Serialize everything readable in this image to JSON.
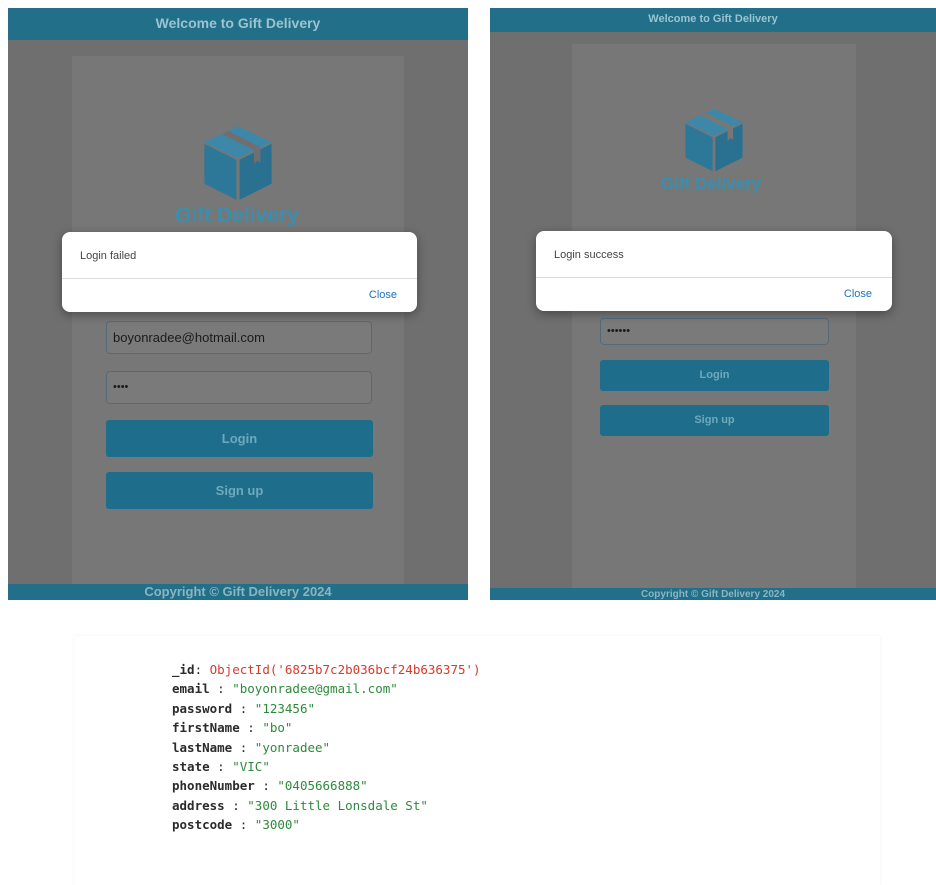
{
  "left_screen": {
    "header": "Welcome to Gift Delivery",
    "brand": "Gift Delivery",
    "email_value": "boyonradee@hotmail.com",
    "password_mask": "••••",
    "login_label": "Login",
    "signup_label": "Sign up",
    "footer": "Copyright © Gift Delivery 2024",
    "dialog": {
      "message": "Login failed",
      "close_label": "Close"
    }
  },
  "right_screen": {
    "header": "Welcome to Gift Delivery",
    "brand": "Gift Delivery",
    "password_mask": "••••••",
    "login_label": "Login",
    "signup_label": "Sign up",
    "footer": "Copyright © Gift Delivery 2024",
    "dialog": {
      "message": "Login success",
      "close_label": "Close"
    }
  },
  "db_record": {
    "id_key": "_id",
    "id_value": "ObjectId('6825b7c2b036bcf24b636375')",
    "fields": [
      {
        "key": "email",
        "value": "\"boyonradee@gmail.com\""
      },
      {
        "key": "password",
        "value": "\"123456\""
      },
      {
        "key": "firstName",
        "value": "\"bo\""
      },
      {
        "key": "lastName",
        "value": "\"yonradee\""
      },
      {
        "key": "state",
        "value": "\"VIC\""
      },
      {
        "key": "phoneNumber",
        "value": "\"0405666888\""
      },
      {
        "key": "address",
        "value": "\"300 Little Lonsdale St\""
      },
      {
        "key": "postcode",
        "value": "\"3000\""
      }
    ]
  },
  "colors": {
    "header_bg": "#216f88",
    "brand": "#3a8eae",
    "button_bg": "#1e6e8b",
    "overlay": "#6f6f6f",
    "link": "#1f72c2",
    "object_id": "#d93a2a",
    "string_value": "#2e8a3b"
  },
  "icons": {
    "logo": "package-box-icon"
  }
}
